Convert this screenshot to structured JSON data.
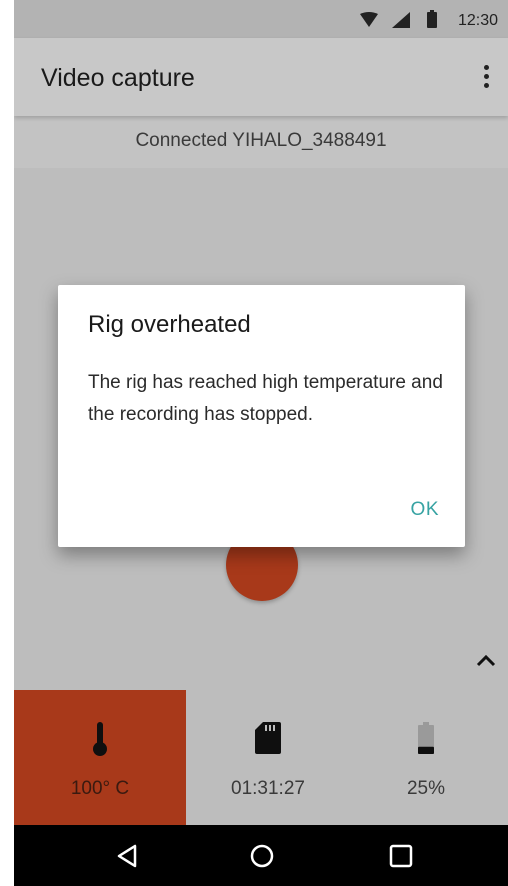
{
  "status_bar": {
    "time": "12:30",
    "icons": [
      "wifi-icon",
      "cell-signal-icon",
      "battery-icon"
    ]
  },
  "app_bar": {
    "title": "Video capture",
    "menu_icon": "more-vert-icon"
  },
  "connection": {
    "text": "Connected YIHALO_3488491"
  },
  "dialog": {
    "title": "Rig overheated",
    "body": "The rig has reached high temperature and the recording has stopped.",
    "ok_label": "OK"
  },
  "stats": {
    "temperature": {
      "icon": "thermometer-icon",
      "value": "100° C"
    },
    "storage": {
      "icon": "sd-card-icon",
      "value": "01:31:27"
    },
    "battery": {
      "icon": "battery-icon",
      "value": "25%",
      "level": 0.25
    }
  },
  "nav_bar": {
    "icons": [
      "back-icon",
      "home-icon",
      "recents-icon"
    ]
  },
  "colors": {
    "accent": "#37a3a3",
    "alert": "#a8391a"
  }
}
